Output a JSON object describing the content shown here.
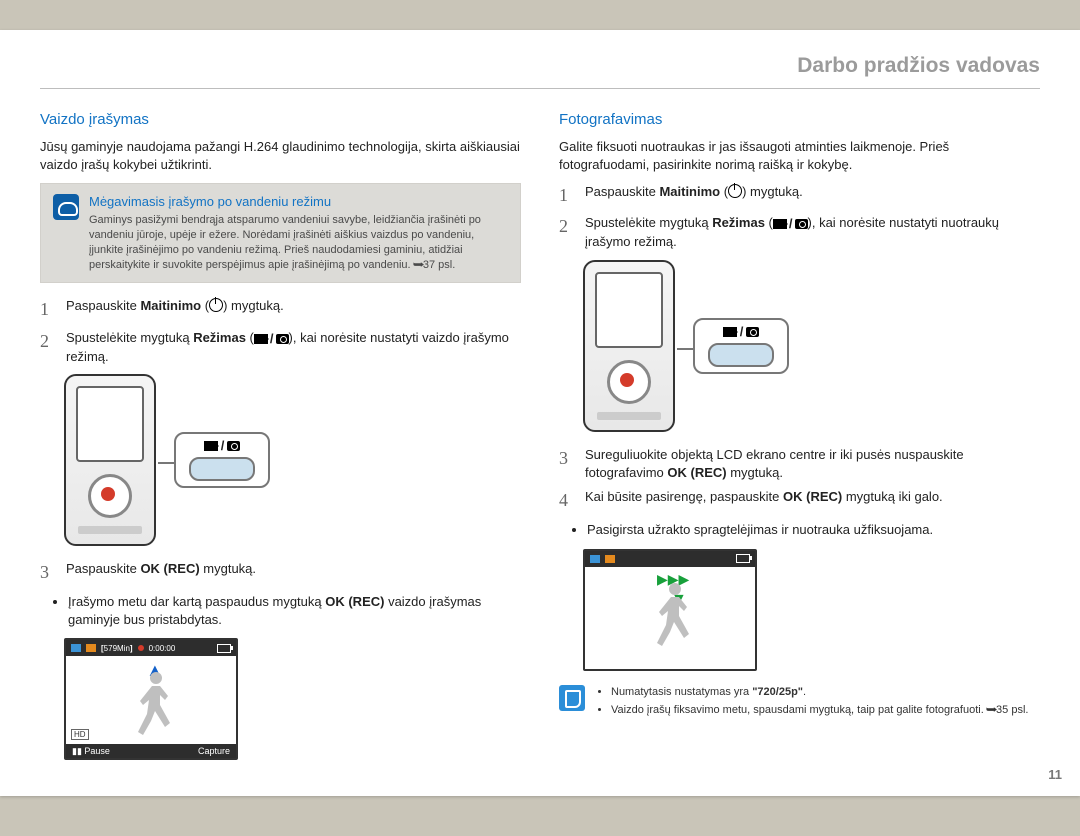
{
  "header_title": "Darbo pradžios vadovas",
  "page_number": "11",
  "left": {
    "heading": "Vaizdo įrašymas",
    "intro": "Jūsų gaminyje naudojama pažangi H.264 glaudinimo technologija, skirta aiškiausiai vaizdo įrašų kokybei užtikrinti.",
    "callout_title": "Mėgavimasis įrašymo po vandeniu režimu",
    "callout_body": "Gaminys pasižymi bendrąja atsparumo vandeniui savybe, leidžiančia įrašinėti po vandeniu jūroje, upėje ir ežere. Norėdami įrašinėti aiškius vaizdus po vandeniu, įjunkite įrašinėjimo po vandeniu režimą. Prieš naudodamiesi gaminiu, atidžiai perskaitykite ir suvokite perspėjimus apie įrašinėjimą po vandeniu.",
    "callout_ref": "37 psl.",
    "step1_a": "Paspauskite ",
    "step1_b": "Maitinimo",
    "step1_c": " (",
    "step1_d": ") mygtuką.",
    "step2_a": "Spustelėkite mygtuką ",
    "step2_b": "Režimas",
    "step2_c": " (",
    "step2_d": "), kai norėsite nustatyti vaizdo įrašymo režimą.",
    "step3_a": "Paspauskite ",
    "step3_b": "OK (REC)",
    "step3_c": " mygtuką.",
    "step3_sub_a": "Įrašymo metu dar kartą paspaudus mygtuką ",
    "step3_sub_b": "OK (REC)",
    "step3_sub_c": " vaizdo įrašymas gaminyje bus pristabdytas.",
    "lcd_time_remaining": "579Min",
    "lcd_timer": "0:00:00",
    "lcd_hd": "HD",
    "lcd_pause": "Pause",
    "lcd_capture": "Capture"
  },
  "right": {
    "heading": "Fotografavimas",
    "intro": "Galite fiksuoti nuotraukas ir jas išsaugoti atminties laikmenoje. Prieš fotografuodami, pasirinkite norimą raišką ir kokybę.",
    "step1_a": "Paspauskite ",
    "step1_b": "Maitinimo",
    "step1_c": " (",
    "step1_d": ") mygtuką.",
    "step2_a": "Spustelėkite mygtuką ",
    "step2_b": "Režimas",
    "step2_c": " (",
    "step2_d": "), kai norėsite nustatyti nuotraukų įrašymo režimą.",
    "step3_a": "Sureguliuokite objektą LCD ekrano centre ir iki pusės nuspauskite fotografavimo ",
    "step3_b": "OK (REC)",
    "step3_c": " mygtuką.",
    "step4_a": "Kai būsite pasirengę, paspauskite ",
    "step4_b": "OK (REC)",
    "step4_c": " mygtuką iki galo.",
    "step4_sub": "Pasigirsta užrakto spragtelėjimas ir nuotrauka užfiksuojama.",
    "note1_a": "Numatytasis nustatymas yra ",
    "note1_b": "\"720/25p\"",
    "note1_c": ".",
    "note2": "Vaizdo įrašų fiksavimo metu, spausdami mygtuką, taip pat galite fotografuoti.",
    "note2_ref": "35 psl."
  }
}
